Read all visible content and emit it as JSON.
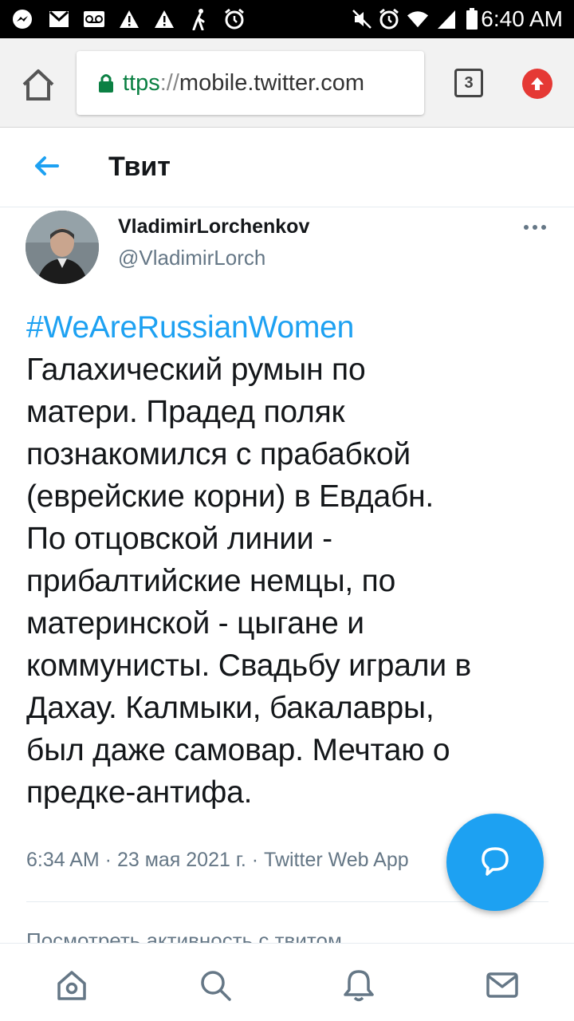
{
  "status_bar": {
    "time": "6:40 AM",
    "icons": [
      "messenger-icon",
      "gmail-icon",
      "voicemail-icon",
      "warning-icon",
      "warning-icon",
      "walking-icon",
      "alarm-clock-icon",
      "mute-icon",
      "alarm-icon",
      "wifi-icon",
      "signal-icon",
      "battery-icon"
    ]
  },
  "browser": {
    "url_scheme": "ttps",
    "url_sep": "://",
    "url_host": "mobile.twitter.com",
    "tab_count": "3",
    "icons": [
      "home-icon",
      "lock-icon",
      "tabs-icon",
      "update-icon"
    ]
  },
  "header": {
    "title": "Твит",
    "back_icon": "arrow-left-icon"
  },
  "tweet": {
    "display_name": "VladimirLorchenkov",
    "handle": "@VladimirLorch",
    "hashtag": "#WeAreRussianWomen",
    "lines": [
      "Галахический румын по",
      "матери. Прадед поляк",
      "познакомился с прабабкой",
      "(еврейские корни) в Евдабн.",
      "По отцовской линии -",
      "прибалтийские немцы, по",
      "материнской - цыгане и",
      "коммунисты. Свадьбу играли в",
      "Дахау. Калмыки, бакалавры,",
      "был даже самовар. Мечтаю о",
      "предке-антифа."
    ],
    "meta": "6:34 AM · 23 мая 2021 г. · Twitter Web App",
    "activity_link": "Посмотреть активность с твитом"
  },
  "fab": {
    "icon": "compose-icon"
  },
  "bottom_nav": {
    "items": [
      "home-icon",
      "search-icon",
      "notifications-icon",
      "messages-icon"
    ]
  },
  "colors": {
    "accent": "#1da1f2",
    "text": "#14171a",
    "secondary": "#657786",
    "url_green": "#0b8043",
    "update_red": "#e53935"
  }
}
